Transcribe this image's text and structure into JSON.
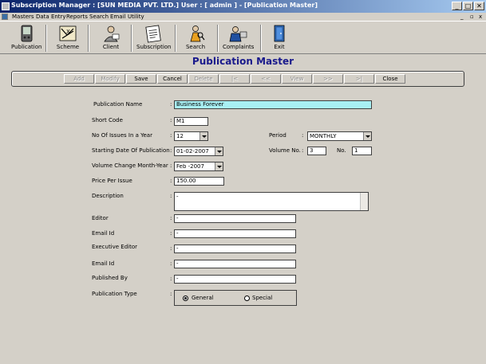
{
  "window": {
    "title": "Subscription Manager : [SUN MEDIA PVT. LTD.] User : [ admin ] - [Publication Master]",
    "min_label": "_",
    "max_label": "□",
    "close_label": "✕"
  },
  "menu": {
    "items": [
      "Masters",
      "Data Entry",
      "Reports",
      "Search",
      "Email",
      "Utility"
    ],
    "mdi_min": "_",
    "mdi_restore": "▫",
    "mdi_close": "x"
  },
  "toolbar": {
    "buttons": [
      {
        "label": "Publication",
        "icon": "pda-icon"
      },
      {
        "label": "Scheme",
        "icon": "scheme-map-icon"
      },
      {
        "label": "Client",
        "icon": "client-icon"
      },
      {
        "label": "Subscription",
        "icon": "newspaper-icon"
      },
      {
        "label": "Search",
        "icon": "search-person-icon"
      },
      {
        "label": "Complaints",
        "icon": "complaints-icon"
      },
      {
        "label": "Exit",
        "icon": "exit-door-icon"
      }
    ]
  },
  "heading": "Publication Master",
  "actions": {
    "add": "Add",
    "modify": "Modify",
    "save": "Save",
    "cancel": "Cancel",
    "delete": "Delete",
    "first": "|<",
    "prev": "<<",
    "view": "View",
    "next": ">>",
    "last": ">|",
    "close": "Close"
  },
  "form": {
    "colon": ":",
    "publication_name": {
      "label": "Publication Name",
      "value": "Business Forever"
    },
    "short_code": {
      "label": "Short Code",
      "value": "M1"
    },
    "issues_per_year": {
      "label": "No Of Issues In a Year",
      "value": "12"
    },
    "period": {
      "label": "Period",
      "value": "MONTHLY"
    },
    "start_date": {
      "label": "Starting Date Of Publication",
      "value": "01-02-2007"
    },
    "volume_no": {
      "label": "Volume No.",
      "value": "3"
    },
    "no": {
      "label": "No.",
      "value": "1"
    },
    "volume_change": {
      "label": "Volume Change Month-Year",
      "value": "Feb -2007"
    },
    "price_per_issue": {
      "label": "Price Per Issue",
      "value": "150.00"
    },
    "description": {
      "label": "Description",
      "value": "-"
    },
    "editor": {
      "label": "Editor",
      "value": "-"
    },
    "email1": {
      "label": "Email Id",
      "value": "-"
    },
    "exec_editor": {
      "label": "Executive Editor",
      "value": "-"
    },
    "email2": {
      "label": "Email Id",
      "value": "-"
    },
    "published_by": {
      "label": "Published By",
      "value": "-"
    },
    "publication_type": {
      "label": "Publication Type",
      "options": [
        {
          "label": "General",
          "selected": true
        },
        {
          "label": "Special",
          "selected": false
        }
      ]
    }
  }
}
